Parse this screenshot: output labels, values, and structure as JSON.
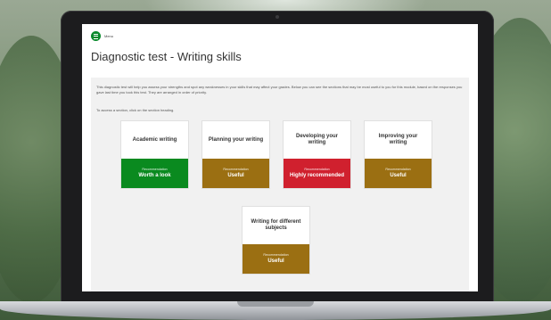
{
  "menu": {
    "label": "Menu"
  },
  "page": {
    "title": "Diagnostic test - Writing skills",
    "intro": "This diagnostic test will help you assess your strengths and spot any weaknesses in your skills that may affect your grades. Below you can see the sections that may be most useful to you for this module, based on the responses you gave last time you took this test. They are arranged in order of priority.",
    "hint": "To access a section, click on the section heading."
  },
  "cards": [
    {
      "title": "Academic writing",
      "rec_label": "Recommendation",
      "rec_value": "Worth a look",
      "color": "#0a8a1f"
    },
    {
      "title": "Planning your writing",
      "rec_label": "Recommendation",
      "rec_value": "Useful",
      "color": "#9b6f12"
    },
    {
      "title": "Developing your writing",
      "rec_label": "Recommendation",
      "rec_value": "Highly recommended",
      "color": "#d0202e"
    },
    {
      "title": "Improving your writing",
      "rec_label": "Recommendation",
      "rec_value": "Useful",
      "color": "#9b6f12"
    },
    {
      "title": "Writing for different subjects",
      "rec_label": "Recommendation",
      "rec_value": "Useful",
      "color": "#9b6f12"
    }
  ]
}
